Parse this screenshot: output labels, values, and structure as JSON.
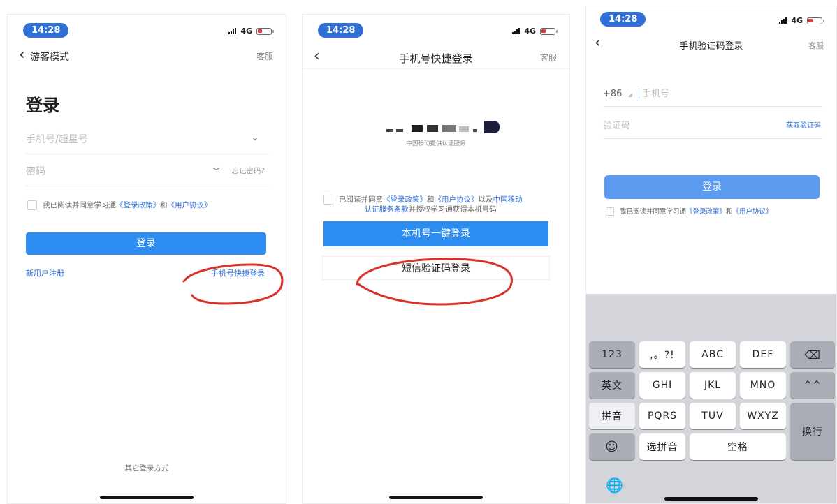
{
  "screens": [
    {
      "status": {
        "time": "14:28",
        "network": "4G"
      },
      "nav": {
        "back_label": "游客模式",
        "right": "客服"
      },
      "title": "登录",
      "phone_placeholder": "手机号/超星号",
      "password_placeholder": "密码",
      "forgot": "忘记密码?",
      "agree": {
        "prefix": "我已阅读并同意学习通",
        "policy": "《登录政策》",
        "and": "和",
        "agreement": "《用户协议》"
      },
      "login_button": "登录",
      "register_link": "新用户注册",
      "quick_login_link": "手机号快捷登录",
      "other_methods": "其它登录方式"
    },
    {
      "status": {
        "time": "14:28",
        "network": "4G"
      },
      "nav": {
        "title": "手机号快捷登录",
        "right": "客服"
      },
      "masked_number_caption": "中国移动提供认证服务",
      "agree": {
        "prefix": "已阅读并同意",
        "policy": "《登录政策》",
        "and": "和",
        "agreement": "《用户协议》",
        "and2": "以及",
        "carrier": "中国移动",
        "line2_link": "认证服务条款",
        "line2_rest": "并授权学习通获得本机号码"
      },
      "one_click_button": "本机号一键登录",
      "sms_button": "短信验证码登录"
    },
    {
      "status": {
        "time": "14:28",
        "network": "4G"
      },
      "nav": {
        "title": "手机验证码登录",
        "right": "客服"
      },
      "country_code": "+86",
      "phone_placeholder": "手机号",
      "code_placeholder": "验证码",
      "get_code": "获取验证码",
      "login_button": "登录",
      "agree": {
        "prefix": "我已阅读并同意学习通",
        "policy": "《登录政策》",
        "and": "和",
        "agreement": "《用户协议》"
      },
      "keyboard": {
        "k123": "123",
        "punct": ",。?!",
        "abc": "ABC",
        "def": "DEF",
        "english": "英文",
        "ghi": "GHI",
        "jkl": "JKL",
        "mno": "MNO",
        "face": "^^",
        "pinyin": "拼音",
        "pqrs": "PQRS",
        "tuv": "TUV",
        "wxyz": "WXYZ",
        "select": "选拼音",
        "space": "空格",
        "newline": "换行"
      }
    }
  ],
  "colors": {
    "accent": "#2d8cf0",
    "link": "#2f6fd6",
    "annotation": "#d8322b"
  }
}
